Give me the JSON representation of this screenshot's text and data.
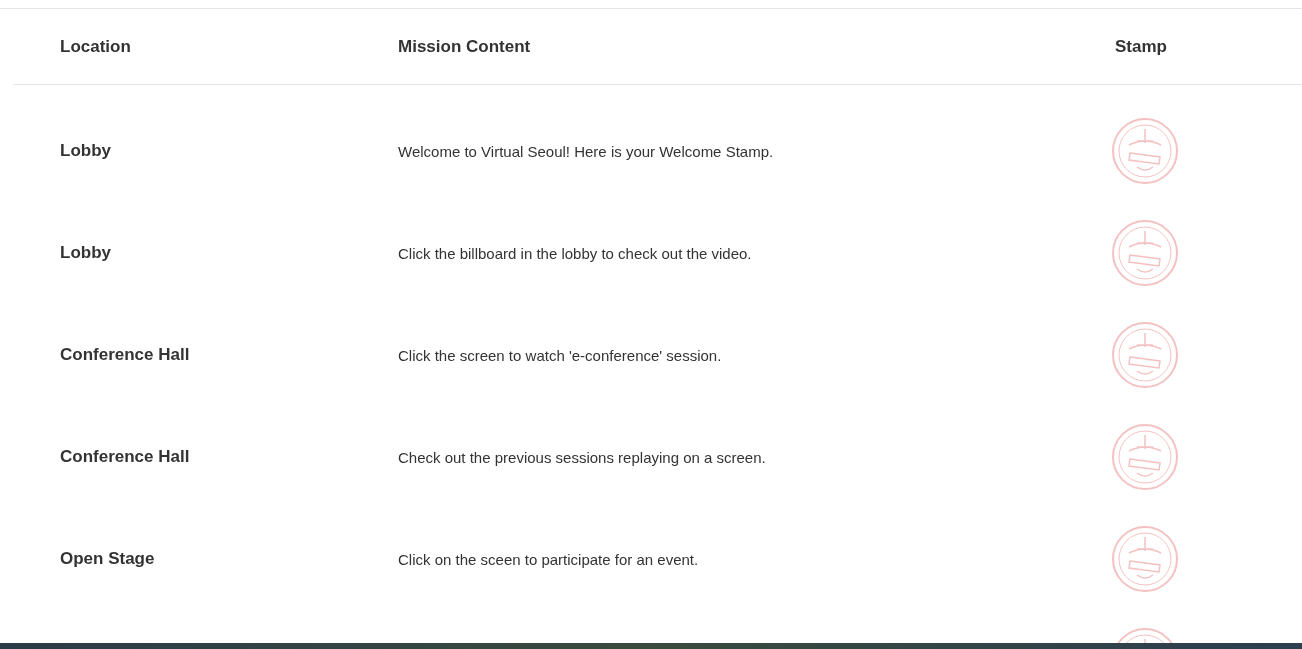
{
  "table": {
    "columns": [
      "Location",
      "Mission Content",
      "Stamp"
    ],
    "rows": [
      {
        "location": "Lobby",
        "mission": "Welcome to Virtual Seoul! Here is your Welcome Stamp.",
        "collected": false
      },
      {
        "location": "Lobby",
        "mission": "Click the billboard in the lobby to check out the video.",
        "collected": false
      },
      {
        "location": "Conference Hall",
        "mission": "Click the screen to watch 'e-conference' session.",
        "collected": false
      },
      {
        "location": "Conference Hall",
        "mission": "Check out the previous sessions replaying on a screen.",
        "collected": false
      },
      {
        "location": "Open Stage",
        "mission": "Click on the sceen to participate for an event.",
        "collected": false
      }
    ],
    "partial_row": {
      "collected": false
    }
  }
}
